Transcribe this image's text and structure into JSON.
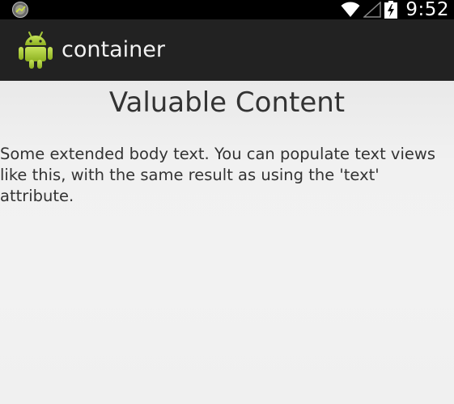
{
  "status_bar": {
    "time": "9:52",
    "icons": [
      "app-notification-icon",
      "wifi-icon",
      "signal-icon",
      "battery-charging-icon"
    ]
  },
  "action_bar": {
    "title": "container",
    "app_icon": "android-icon",
    "background": "#222222"
  },
  "content": {
    "heading": "Valuable Content",
    "body": "Some extended body text. You can populate text views like this, with the same result as using the 'text' attribute."
  },
  "colors": {
    "android_green": "#a4c639",
    "text": "#333333"
  }
}
